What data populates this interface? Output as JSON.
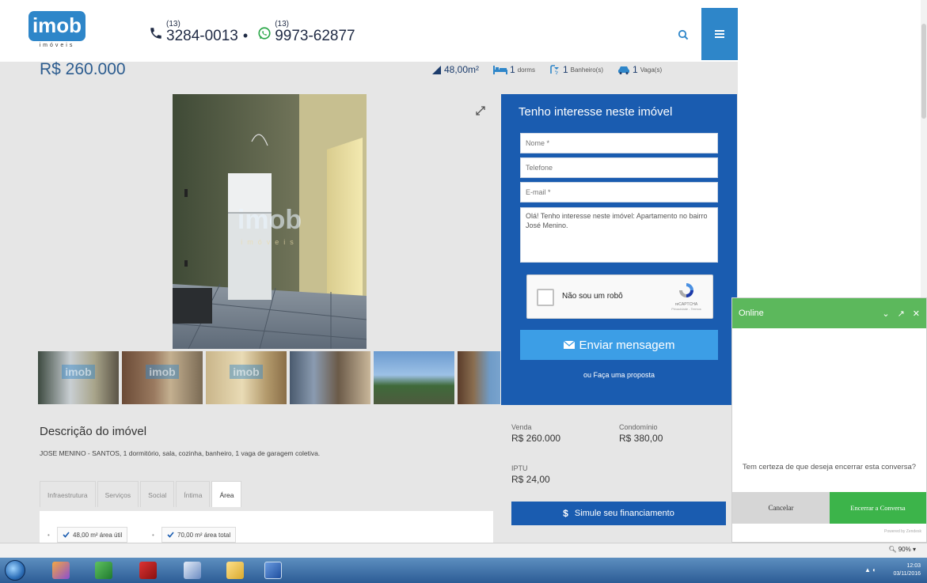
{
  "header": {
    "logo_text": "imob",
    "logo_subtext": "imóveis",
    "phone_ddd": "(13)",
    "phone_number": "3284-0013",
    "separator": "•",
    "whatsapp_ddd": "(13)",
    "whatsapp_number": "9973-62877"
  },
  "property": {
    "price": "R$ 260.000",
    "area": "48,00m²",
    "bedrooms": "1",
    "bedrooms_label": "dorms",
    "bathrooms": "1",
    "bathrooms_label": "Banheiro(s)",
    "parking": "1",
    "parking_label": "Vaga(s)",
    "photo_watermark": "imob",
    "photo_watermark_sub": "imóveis",
    "thumb_watermark": "imob"
  },
  "form": {
    "title": "Tenho interesse neste imóvel",
    "name_placeholder": "Nome *",
    "phone_placeholder": "Telefone",
    "email_placeholder": "E-mail *",
    "message_value": "Olá! Tenho interesse neste imóvel: Apartamento no bairro José Menino.",
    "captcha_label": "Não sou um robô",
    "captcha_brand": "reCAPTCHA",
    "captcha_links": "Privacidade - Termos",
    "send_label": "Enviar mensagem",
    "proposal_label": "ou Faça uma proposta"
  },
  "description": {
    "title": "Descrição do imóvel",
    "text": "JOSE MENINO - SANTOS, 1 dormitório, sala, cozinha, banheiro, 1 vaga de garagem coletiva.",
    "tabs": [
      "Infraestrutura",
      "Serviços",
      "Social",
      "Íntima",
      "Área"
    ],
    "active_tab": "Área",
    "chips": [
      "48,00 m² área útil",
      "70,00 m² área total"
    ]
  },
  "values": {
    "venda_label": "Venda",
    "venda_value": "R$ 260.000",
    "condominio_label": "Condomínio",
    "condominio_value": "R$ 380,00",
    "iptu_label": "IPTU",
    "iptu_value": "R$ 24,00",
    "simulate_label": "Simule seu financiamento"
  },
  "chat": {
    "status": "Online",
    "message": "Tem certeza de que deseja encerrar esta conversa?",
    "cancel_label": "Cancelar",
    "end_label": "Encerrar a Conversa",
    "powered": "Powered by Zendesk"
  },
  "browser": {
    "zoom": "90%"
  },
  "taskbar": {
    "time": "12:03",
    "date": "03/11/2016"
  },
  "colors": {
    "brand_blue": "#2e86c9",
    "form_blue": "#1a5cb0",
    "button_blue": "#3c9ee6",
    "chat_green": "#5cb85c",
    "end_green": "#3cb44a"
  }
}
